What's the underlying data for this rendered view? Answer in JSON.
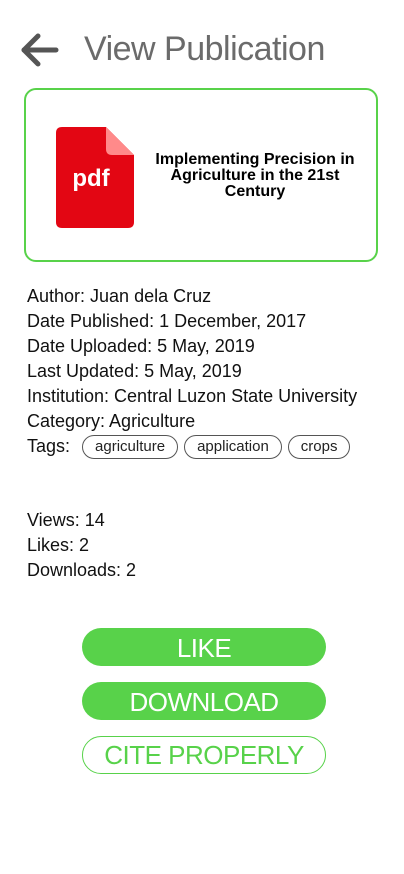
{
  "header": {
    "title": "View Publication",
    "back_icon": "arrow-left-icon"
  },
  "publication": {
    "file_type_label": "pdf",
    "title": "Implementing Precision in Agriculture in the 21st Century",
    "icon": "pdf-file-icon",
    "icon_color": "#e30613"
  },
  "meta": {
    "author": "Author: Juan dela Cruz",
    "date_published": "Date Published: 1 December, 2017",
    "date_uploaded": "Date Uploaded: 5 May, 2019",
    "last_updated": "Last Updated: 5 May, 2019",
    "institution": "Institution: Central Luzon State University",
    "category": "Category: Agriculture",
    "tags_label": "Tags:",
    "tags": [
      "agriculture",
      "application",
      "crops"
    ]
  },
  "stats": {
    "views": "Views: 14",
    "likes": "Likes: 2",
    "downloads": "Downloads: 2"
  },
  "actions": {
    "like": "LIKE",
    "download": "DOWNLOAD",
    "cite": "CITE PROPERLY"
  },
  "colors": {
    "accent": "#58d24a",
    "title_gray": "#6b6b6b"
  }
}
